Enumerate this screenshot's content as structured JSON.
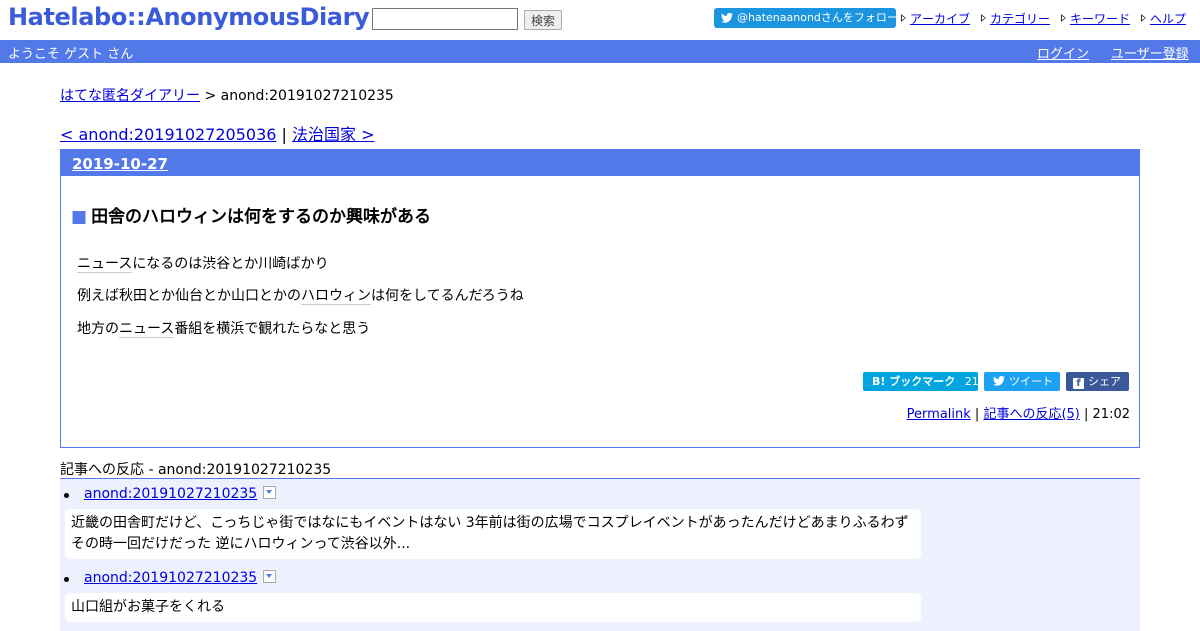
{
  "header": {
    "logo": "Hatelabo::AnonymousDiary",
    "search_placeholder": "",
    "search_button": "検索",
    "follow": "@hatenaanondさんをフォロー",
    "nav": [
      "アーカイブ",
      "カテゴリー",
      "キーワード",
      "ヘルプ"
    ]
  },
  "userbar": {
    "welcome": "ようこそ ゲスト さん",
    "login": "ログイン",
    "register": "ユーザー登録"
  },
  "breadcrumb": {
    "home": "はてな匿名ダイアリー",
    "sep": ">",
    "current": "anond:20191027210235"
  },
  "prevnext": {
    "prev": "< anond:20191027205036",
    "sep": "|",
    "next": "法治国家 >"
  },
  "entry": {
    "date": "2019-10-27",
    "title_marker": "■",
    "title": "田舎のハロウィンは何をするのか興味がある",
    "p1_kw": "ニュース",
    "p1_rest": "になるのは渋谷とか川崎ばかり",
    "p2_pre": "例えば秋田とか仙台とか山口とかの",
    "p2_kw": "ハロウィン",
    "p2_rest": "は何をしてるんだろうね",
    "p3_pre": "地方の",
    "p3_kw": "ニュース",
    "p3_rest": "番組を横浜で観れたらなと思う",
    "bookmark_label": "B! ブックマーク",
    "bookmark_count": "21",
    "tweet_label": "ツイート",
    "share_label": "シェア",
    "permalink": "Permalink",
    "reactions_link": "記事への反応(5)",
    "time": "21:02"
  },
  "reactions": {
    "heading": "記事への反応 - anond:20191027210235",
    "items": [
      {
        "id": "anond:20191027210235",
        "text_line1": "近畿の田舎町だけど、こっちじゃ街ではなにもイベントはない 3年前は街の広場でコスプレイベントがあったんだけどあまりふるわず",
        "text_line2": "その時一回だけだった 逆にハロウィンって渋谷以外..."
      },
      {
        "id": "anond:20191027210235",
        "text_line1": "山口組がお菓子をくれる"
      }
    ]
  },
  "colors": {
    "accent": "#5279e7",
    "link": "#0000dd",
    "reaction_bg": "#edf1fd"
  }
}
